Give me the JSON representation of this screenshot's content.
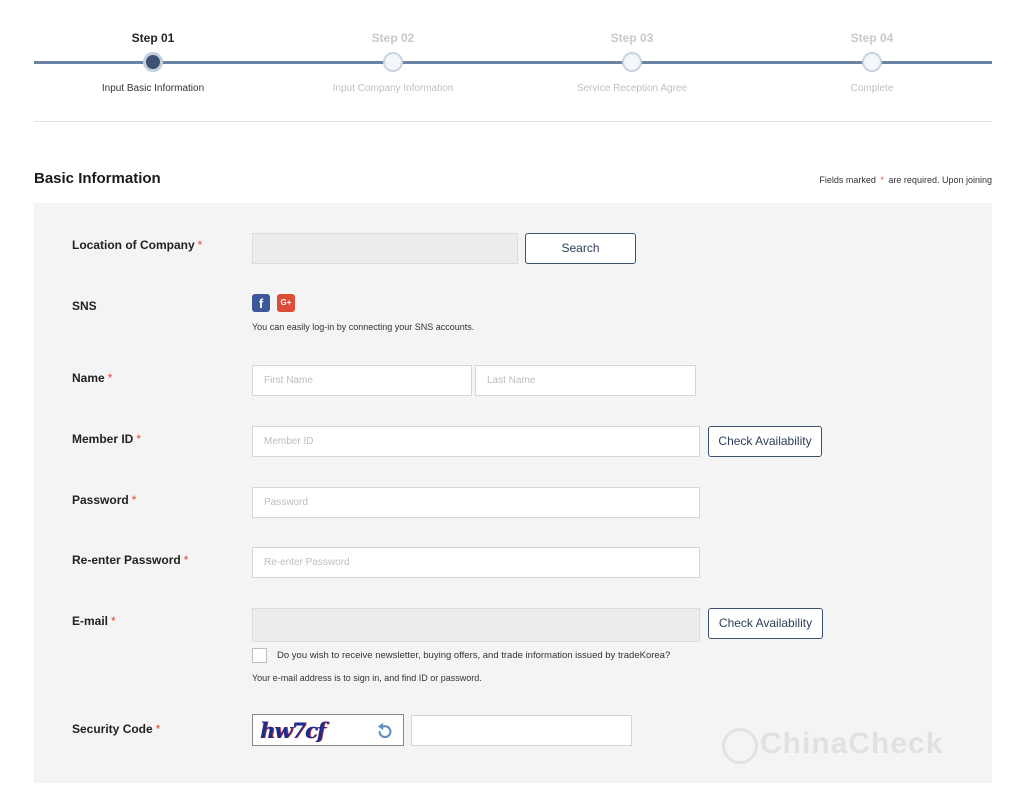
{
  "stepper": {
    "steps": [
      {
        "number": "Step 01",
        "label": "Input Basic Information",
        "active": true
      },
      {
        "number": "Step 02",
        "label": "Input Company Information",
        "active": false
      },
      {
        "number": "Step 03",
        "label": "Service Reception Agree",
        "active": false
      },
      {
        "number": "Step 04",
        "label": "Complete",
        "active": false
      }
    ]
  },
  "section": {
    "title": "Basic Information",
    "required_prefix": "Fields marked",
    "required_star": "*",
    "required_suffix": "are required. Upon joining"
  },
  "form": {
    "location": {
      "label": "Location of Company",
      "value": "",
      "search_button": "Search"
    },
    "sns": {
      "label": "SNS",
      "facebook_icon": "f",
      "google_icon": "G+",
      "hint": "You can easily log-in by connecting your SNS accounts."
    },
    "name": {
      "label": "Name",
      "first_placeholder": "First Name",
      "last_placeholder": "Last Name"
    },
    "member_id": {
      "label": "Member ID",
      "placeholder": "Member ID",
      "check_button": "Check Availability"
    },
    "password": {
      "label": "Password",
      "placeholder": "Password"
    },
    "reenter_password": {
      "label": "Re-enter Password",
      "placeholder": "Re-enter Password"
    },
    "email": {
      "label": "E-mail",
      "value": "",
      "check_button": "Check Availability",
      "newsletter_label": "Do you wish to receive newsletter, buying offers, and trade information issued by tradeKorea?",
      "newsletter_checked": false,
      "hint": "Your e-mail address is to sign in, and find ID or password."
    },
    "security_code": {
      "label": "Security Code",
      "captcha_text": "hw7cf",
      "value": ""
    },
    "required_star": "*"
  },
  "watermark": {
    "text": "ChinaCheck"
  },
  "colors": {
    "accent": "#3d5273",
    "stepper_line": "#6b84a5",
    "required": "#e0463d",
    "facebook": "#3b5998",
    "google": "#dd4b39",
    "panel_bg": "#f4f4f4"
  }
}
